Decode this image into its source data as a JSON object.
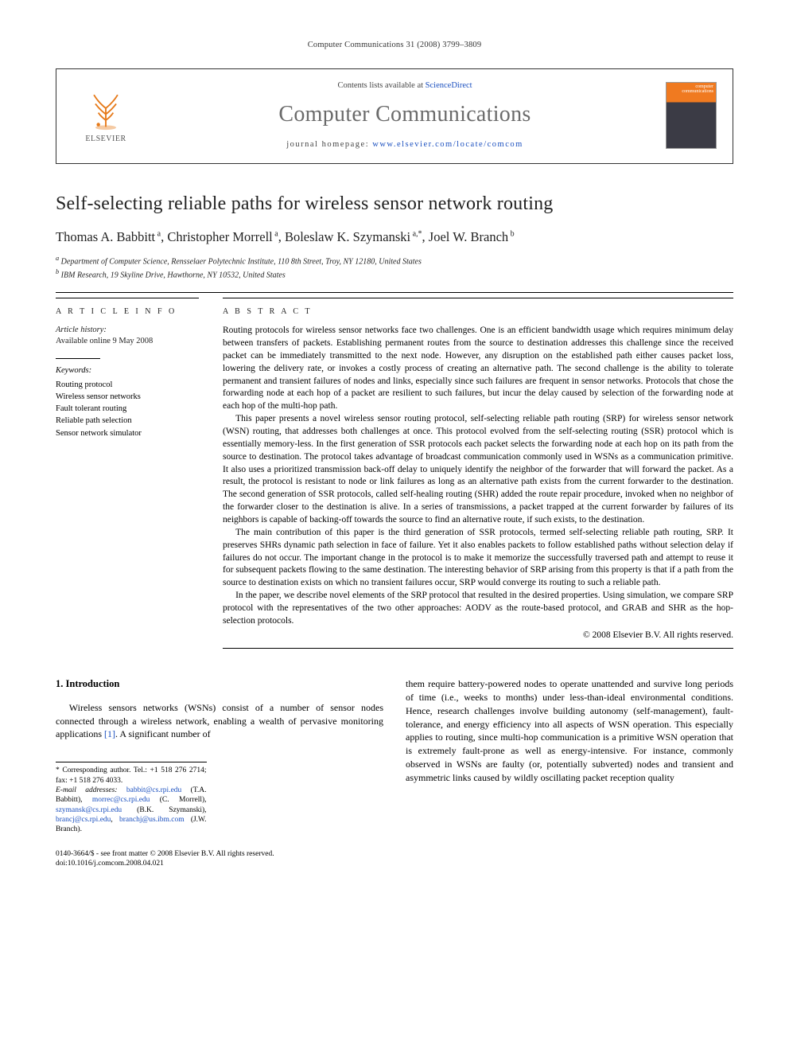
{
  "running_head": "Computer Communications 31 (2008) 3799–3809",
  "masthead": {
    "contents_prefix": "Contents lists available at ",
    "contents_link": "ScienceDirect",
    "journal": "Computer Communications",
    "homepage_prefix": "journal homepage: ",
    "homepage_link": "www.elsevier.com/locate/comcom",
    "publisher": "ELSEVIER",
    "cover_label": "computer\ncommunications"
  },
  "article": {
    "title": "Self-selecting reliable paths for wireless sensor network routing",
    "authors_html": "Thomas A. Babbitt ᵃ, Christopher Morrell ᵃ, Boleslaw K. Szymanski ᵃ,*, Joel W. Branch ᵇ",
    "affiliations": {
      "a": "Department of Computer Science, Rensselaer Polytechnic Institute, 110 8th Street, Troy, NY 12180, United States",
      "b": "IBM Research, 19 Skyline Drive, Hawthorne, NY 10532, United States"
    }
  },
  "meta": {
    "info_label": "A R T I C L E   I N F O",
    "history_label": "Article history:",
    "history_value": "Available online 9 May 2008",
    "keywords_label": "Keywords:",
    "keywords": [
      "Routing protocol",
      "Wireless sensor networks",
      "Fault tolerant routing",
      "Reliable path selection",
      "Sensor network simulator"
    ]
  },
  "abstract": {
    "label": "A B S T R A C T",
    "paragraphs": [
      "Routing protocols for wireless sensor networks face two challenges. One is an efficient bandwidth usage which requires minimum delay between transfers of packets. Establishing permanent routes from the source to destination addresses this challenge since the received packet can be immediately transmitted to the next node. However, any disruption on the established path either causes packet loss, lowering the delivery rate, or invokes a costly process of creating an alternative path. The second challenge is the ability to tolerate permanent and transient failures of nodes and links, especially since such failures are frequent in sensor networks. Protocols that chose the forwarding node at each hop of a packet are resilient to such failures, but incur the delay caused by selection of the forwarding node at each hop of the multi-hop path.",
      "This paper presents a novel wireless sensor routing protocol, self-selecting reliable path routing (SRP) for wireless sensor network (WSN) routing, that addresses both challenges at once. This protocol evolved from the self-selecting routing (SSR) protocol which is essentially memory-less. In the first generation of SSR protocols each packet selects the forwarding node at each hop on its path from the source to destination. The protocol takes advantage of broadcast communication commonly used in WSNs as a communication primitive. It also uses a prioritized transmission back-off delay to uniquely identify the neighbor of the forwarder that will forward the packet. As a result, the protocol is resistant to node or link failures as long as an alternative path exists from the current forwarder to the destination. The second generation of SSR protocols, called self-healing routing (SHR) added the route repair procedure, invoked when no neighbor of the forwarder closer to the destination is alive. In a series of transmissions, a packet trapped at the current forwarder by failures of its neighbors is capable of backing-off towards the source to find an alternative route, if such exists, to the destination.",
      "The main contribution of this paper is the third generation of SSR protocols, termed self-selecting reliable path routing, SRP. It preserves SHRs dynamic path selection in face of failure. Yet it also enables packets to follow established paths without selection delay if failures do not occur. The important change in the protocol is to make it memorize the successfully traversed path and attempt to reuse it for subsequent packets flowing to the same destination. The interesting behavior of SRP arising from this property is that if a path from the source to destination exists on which no transient failures occur, SRP would converge its routing to such a reliable path.",
      "In the paper, we describe novel elements of the SRP protocol that resulted in the desired properties. Using simulation, we compare SRP protocol with the representatives of the two other approaches: AODV as the route-based protocol, and GRAB and SHR as the hop-selection protocols."
    ],
    "copyright": "© 2008 Elsevier B.V. All rights reserved."
  },
  "body": {
    "section_number": "1.",
    "section_title": "Introduction",
    "left_para": "Wireless sensors networks (WSNs) consist of a number of sensor nodes connected through a wireless network, enabling a wealth of pervasive monitoring applications [1]. A significant number of",
    "right_para": "them require battery-powered nodes to operate unattended and survive long periods of time (i.e., weeks to months) under less-than-ideal environmental conditions. Hence, research challenges involve building autonomy (self-management), fault-tolerance, and energy efficiency into all aspects of WSN operation. This especially applies to routing, since multi-hop communication is a primitive WSN operation that is extremely fault-prone as well as energy-intensive. For instance, commonly observed in WSNs are faulty (or, potentially subverted) nodes and transient and asymmetric links caused by wildly oscillating packet reception quality"
  },
  "footnotes": {
    "corr": "* Corresponding author. Tel.: +1 518 276 2714; fax: +1 518 276 4033.",
    "emails_label": "E-mail addresses:",
    "emails": [
      {
        "addr": "babbit@cs.rpi.edu",
        "who": "(T.A. Babbitt)"
      },
      {
        "addr": "morrec@cs.rpi.edu",
        "who": "(C. Morrell)"
      },
      {
        "addr": "szymansk@cs.rpi.edu",
        "who": "(B.K. Szymanski)"
      },
      {
        "addr": "brancj@cs.rpi.edu",
        "who": ","
      },
      {
        "addr": "branchj@us.ibm.com",
        "who": "(J.W. Branch)."
      }
    ]
  },
  "footer": {
    "issn": "0140-3664/$ - see front matter © 2008 Elsevier B.V. All rights reserved.",
    "doi": "doi:10.1016/j.comcom.2008.04.021"
  }
}
